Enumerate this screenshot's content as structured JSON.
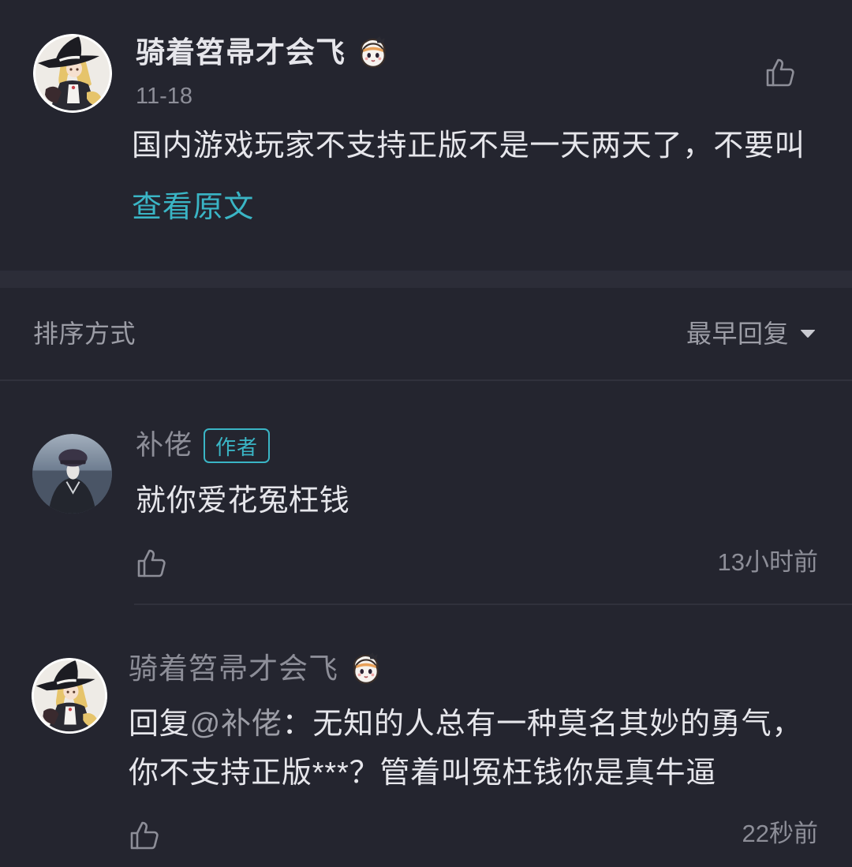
{
  "colors": {
    "background": "#24252f",
    "band": "#2c2d38",
    "divider": "#30313c",
    "text_primary": "#e6e6eb",
    "text_secondary": "#8d8e98",
    "text_tertiary": "#9c9da6",
    "accent": "#3ab5c5"
  },
  "icons": {
    "like": "thumbs-up-icon",
    "user_emoji": "chibi-face-icon",
    "sort_dropdown": "caret-down-icon"
  },
  "post": {
    "author_name": "骑着笤帚才会飞",
    "date": "11-18",
    "text": "国内游戏玩家不支持正版不是一天两天了，不要叫",
    "view_original_label": "查看原文"
  },
  "sort": {
    "label": "排序方式",
    "selected": "最早回复"
  },
  "replies": [
    {
      "author_name": "补佬",
      "badge": "作者",
      "text": "就你爱花冤枉钱",
      "time": "13小时前"
    },
    {
      "author_name": "骑着笤帚才会飞",
      "reply_prefix": "回复",
      "mention": "@补佬",
      "text_line1": "：无知的人总有一种莫名其妙的勇气，",
      "text_line2": "你不支持正版***？管着叫冤枉钱你是真牛逼",
      "time": "22秒前"
    }
  ]
}
